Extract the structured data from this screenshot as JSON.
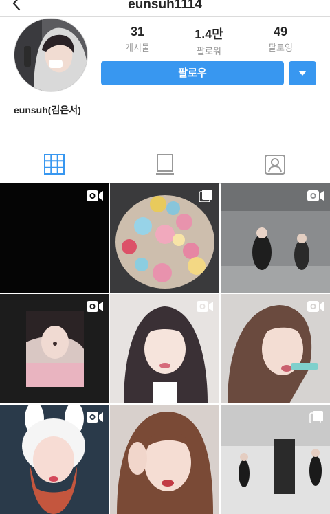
{
  "header": {
    "username_title": "eunsuh1114"
  },
  "profile": {
    "display_name": "eunsuh(김은서)",
    "stats": [
      {
        "value": "31",
        "label": "게시물"
      },
      {
        "value": "1.4만",
        "label": "팔로워"
      },
      {
        "value": "49",
        "label": "팔로잉"
      }
    ],
    "follow_label": "팔로우"
  },
  "tabs": [
    {
      "name": "grid-view",
      "active": true
    },
    {
      "name": "list-view",
      "active": false
    },
    {
      "name": "tagged",
      "active": false
    }
  ],
  "posts": [
    {
      "type": "video",
      "scene": "black frame"
    },
    {
      "type": "carousel",
      "scene": "colorful bouquet of flowers"
    },
    {
      "type": "video",
      "scene": "dance practice in studio"
    },
    {
      "type": "video",
      "scene": "girl with filter effect"
    },
    {
      "type": "video",
      "scene": "girl selfie with filter"
    },
    {
      "type": "video",
      "scene": "girl eating"
    },
    {
      "type": "video",
      "scene": "girl in bunny hat"
    },
    {
      "type": "none",
      "scene": "girl close-up selfie"
    },
    {
      "type": "carousel",
      "scene": "dance practice duo"
    }
  ],
  "colors": {
    "accent": "#3897f0",
    "tab_active": "#3897f0",
    "tab_inactive": "#999999"
  }
}
